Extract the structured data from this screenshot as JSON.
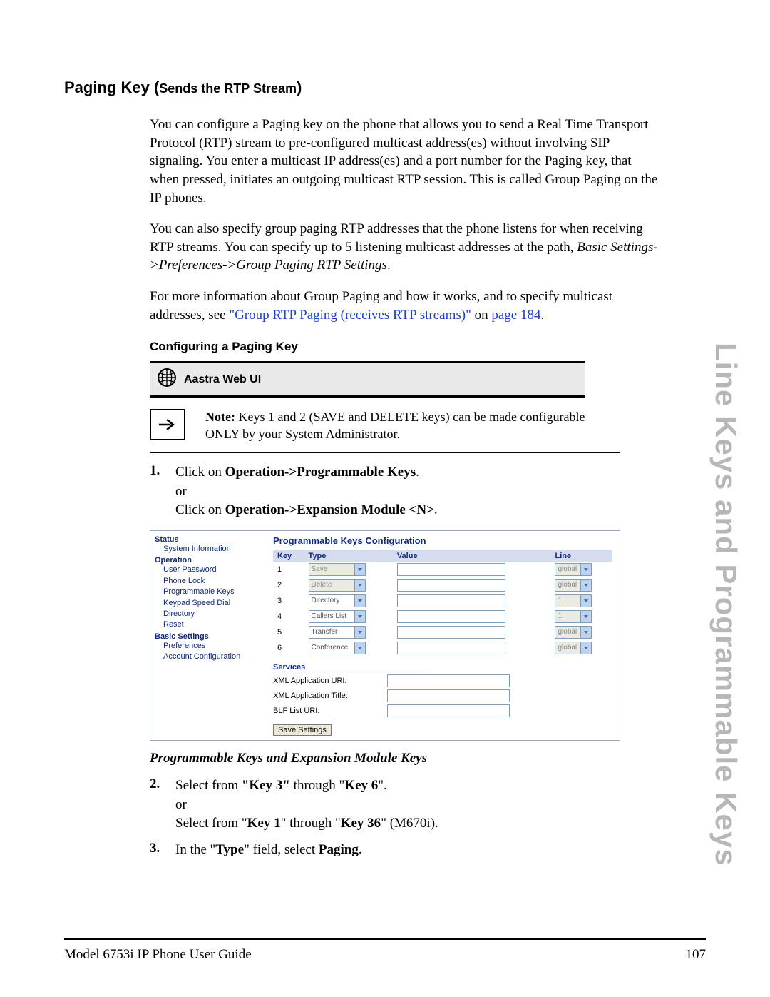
{
  "side_tab": "Line Keys and Programmable Keys",
  "heading": {
    "main": "Paging Key (",
    "sub": "Sends the RTP Stream",
    "close": ")"
  },
  "para1": "You can configure a Paging key on the phone that allows you to send a Real Time Transport Protocol (RTP) stream to pre-configured multicast address(es) without involving SIP signaling. You enter a multicast IP address(es) and a port number for the Paging key, that when pressed, initiates an outgoing multicast RTP session. This is called Group Paging on the IP phones.",
  "para2a": "You can also specify group paging RTP addresses that the phone listens for when receiving RTP streams. You can specify up to 5 listening multicast addresses at the path, ",
  "para2b": "Basic Settings->Preferences->Group Paging RTP Settings",
  "para2c": ".",
  "para3a": "For more information about Group Paging and how it works, and to specify multicast addresses, see ",
  "para3link1": "\"Group RTP Paging (receives RTP streams)\"",
  "para3mid": " on ",
  "para3link2": "page 184",
  "para3end": ".",
  "config_heading": "Configuring a Paging Key",
  "webui_label": "Aastra Web UI",
  "note_label": "Note:",
  "note_text": " Keys 1 and 2 (SAVE and DELETE keys) can be made configurable ONLY by your System Administrator.",
  "steps": {
    "s1": {
      "num": "1.",
      "a": "Click on ",
      "b": "Operation->Programmable Keys",
      "c": ".",
      "or": "or",
      "d": "Click on ",
      "e": "Operation->Expansion Module <N>",
      "f": "."
    },
    "s2": {
      "num": "2.",
      "a": "Select from ",
      "b": "\"Key 3\"",
      "c": " through \"",
      "d": "Key 6",
      "e": "\".",
      "or": "or",
      "f": "Select from \"",
      "g": "Key 1",
      "h": "\" through \"",
      "i": "Key 36",
      "j": "\" (M670i)."
    },
    "s3": {
      "num": "3.",
      "a": "In the \"",
      "b": "Type",
      "c": "\" field, select ",
      "d": "Paging",
      "e": "."
    }
  },
  "sub_italic": "Programmable Keys and Expansion Module Keys",
  "ui": {
    "nav": {
      "status": "Status",
      "status_items": [
        "System Information"
      ],
      "operation": "Operation",
      "operation_items": [
        "User Password",
        "Phone Lock",
        "Programmable Keys",
        "Keypad Speed Dial",
        "Directory",
        "Reset"
      ],
      "basic": "Basic Settings",
      "basic_items": [
        "Preferences",
        "Account Configuration"
      ]
    },
    "title": "Programmable Keys Configuration",
    "cols": {
      "key": "Key",
      "type": "Type",
      "value": "Value",
      "line": "Line"
    },
    "rows": [
      {
        "key": "1",
        "type": "Save",
        "type_disabled": true,
        "line": "global",
        "line_disabled": true
      },
      {
        "key": "2",
        "type": "Delete",
        "type_disabled": true,
        "line": "global",
        "line_disabled": true
      },
      {
        "key": "3",
        "type": "Directory",
        "type_disabled": false,
        "line": "1",
        "line_disabled": true
      },
      {
        "key": "4",
        "type": "Callers List",
        "type_disabled": false,
        "line": "1",
        "line_disabled": true
      },
      {
        "key": "5",
        "type": "Transfer",
        "type_disabled": false,
        "line": "global",
        "line_disabled": true
      },
      {
        "key": "6",
        "type": "Conference",
        "type_disabled": false,
        "line": "global",
        "line_disabled": true
      }
    ],
    "services": {
      "heading": "Services",
      "rows": [
        "XML Application URI:",
        "XML Application Title:",
        "BLF List URI:"
      ]
    },
    "save_btn": "Save Settings"
  },
  "footer": {
    "left": "Model 6753i IP Phone User Guide",
    "right": "107"
  }
}
